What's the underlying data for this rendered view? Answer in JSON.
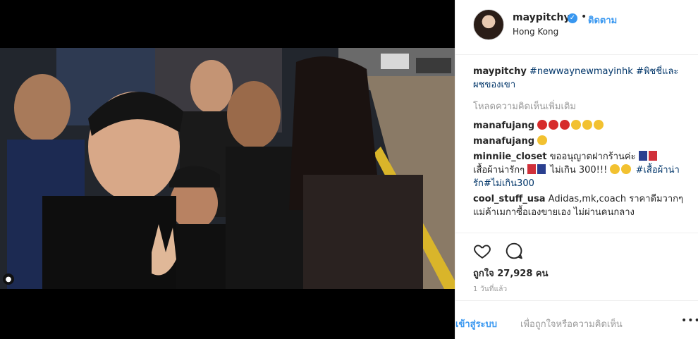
{
  "post": {
    "username": "maypitchy",
    "follow_label": "ติดตาม",
    "location": "Hong Kong",
    "dot": "•"
  },
  "caption": {
    "username": "maypitchy",
    "text": "#newwaynewmayinhk #พิชชี่และผชของเขา"
  },
  "load_more_label": "โหลดความคิดเห็นเพิ่มเติม",
  "comments": [
    {
      "username": "manafujang",
      "text": ""
    },
    {
      "username": "manafujang",
      "text": ""
    },
    {
      "username": "minniie_closet",
      "text_a": "ขออนุญาตฝากร้านค่ะ",
      "text_b": "เสื้อผ้าน่ารักๆ",
      "text_c": "ไม่เกิน 300!!!",
      "tag": "#เสื้อผ้าน่ารัก#ไม่เกิน300"
    },
    {
      "username": "cool_stuff_usa",
      "text": "Adidas,mk,coach ราคาดีมวากๆ แม่ค้าเมกาซื้อเองขายเอง ไม่ผ่านคนกลาง"
    }
  ],
  "likes": {
    "label": "ถูกใจ 27,928 คน"
  },
  "timestamp": "1 วันที่แล้ว",
  "footer": {
    "login": "เข้าสู่ระบบ",
    "rest": "เพื่อถูกใจหรือความคิดเห็น",
    "more": "•••"
  },
  "colors": {
    "link": "#3897f0",
    "hashtag": "#003569",
    "muted": "#999999",
    "text": "#262626"
  },
  "icons": [
    "user-tag-icon",
    "verified-badge-icon",
    "heart-icon",
    "comment-icon",
    "more-options-icon"
  ]
}
